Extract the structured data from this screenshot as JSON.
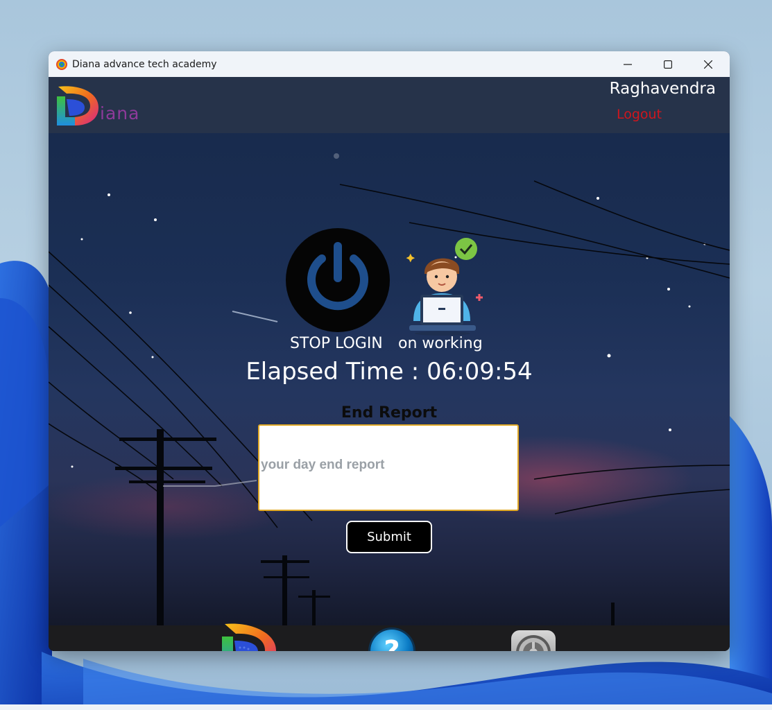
{
  "window": {
    "title": "Diana advance tech academy",
    "controls": {
      "minimize": "minimize",
      "maximize": "maximize",
      "close": "close"
    }
  },
  "header": {
    "logo_text": "iana",
    "username": "Raghavendra",
    "logout_label": "Logout"
  },
  "main": {
    "stop_login_label": "STOP LOGIN",
    "status_label": "on working",
    "elapsed_time": "Elapsed Time : 06:09:54",
    "end_report_title": "End Report",
    "report_input": {
      "value": "",
      "placeholder": "your day end report"
    },
    "submit_label": "Submit"
  },
  "dock": {
    "items": [
      "diana-logo-icon",
      "help-icon",
      "settings-icon"
    ]
  },
  "colors": {
    "accent": "#e0a825",
    "logout": "#d0161d",
    "logo_text": "#8e3a9a",
    "titlebar": "#f0f4f9",
    "taskbar": "#1c1c1e"
  }
}
